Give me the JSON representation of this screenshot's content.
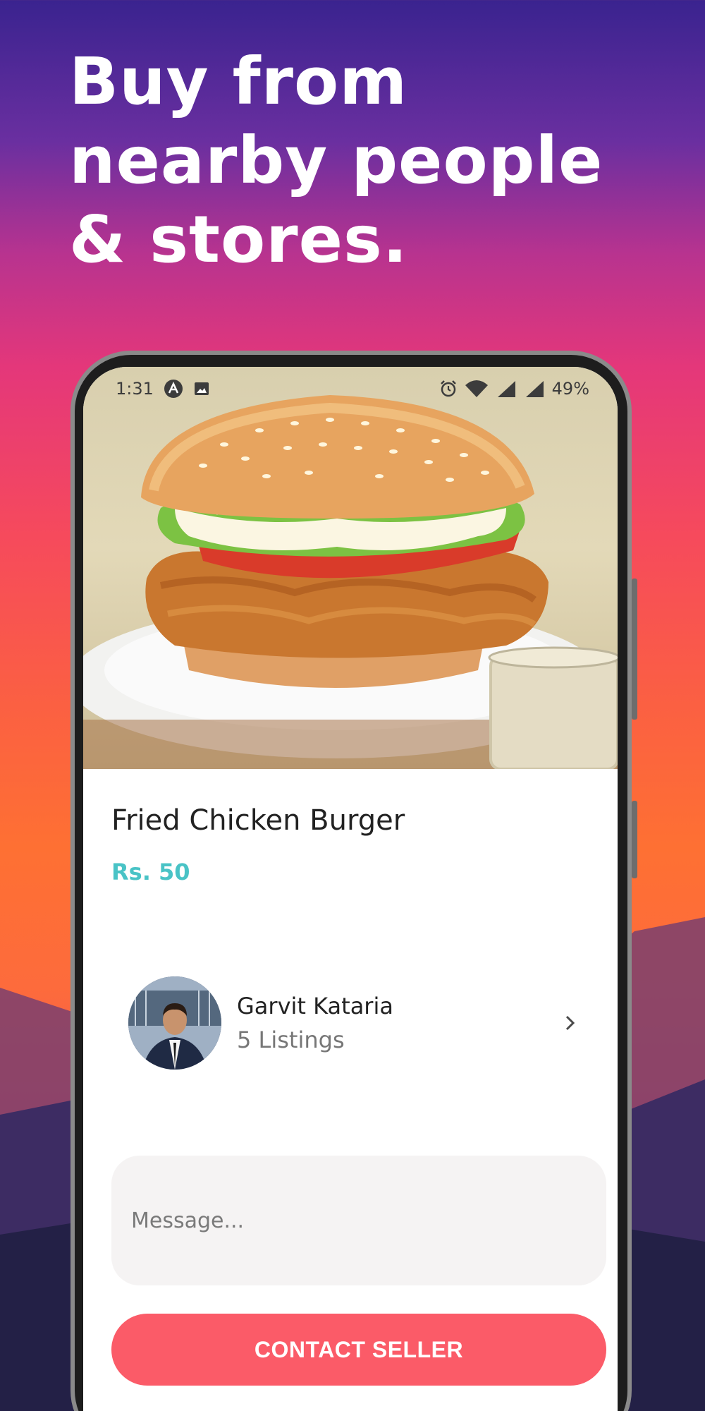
{
  "hero": {
    "title": "Buy from nearby people & stores."
  },
  "status_bar": {
    "time": "1:31",
    "battery": "49%"
  },
  "product": {
    "title": "Fried Chicken Burger",
    "price": "Rs. 50",
    "image_icon": "burger-photo"
  },
  "seller": {
    "name": "Garvit Kataria",
    "listings": "5 Listings",
    "chevron_icon": "chevron-right-icon"
  },
  "message": {
    "placeholder": "Message..."
  },
  "contact_button": {
    "label": "CONTACT SELLER"
  },
  "colors": {
    "accent": "#fb5b68",
    "price": "#49c3c6",
    "message_bg": "#f5f3f3"
  }
}
